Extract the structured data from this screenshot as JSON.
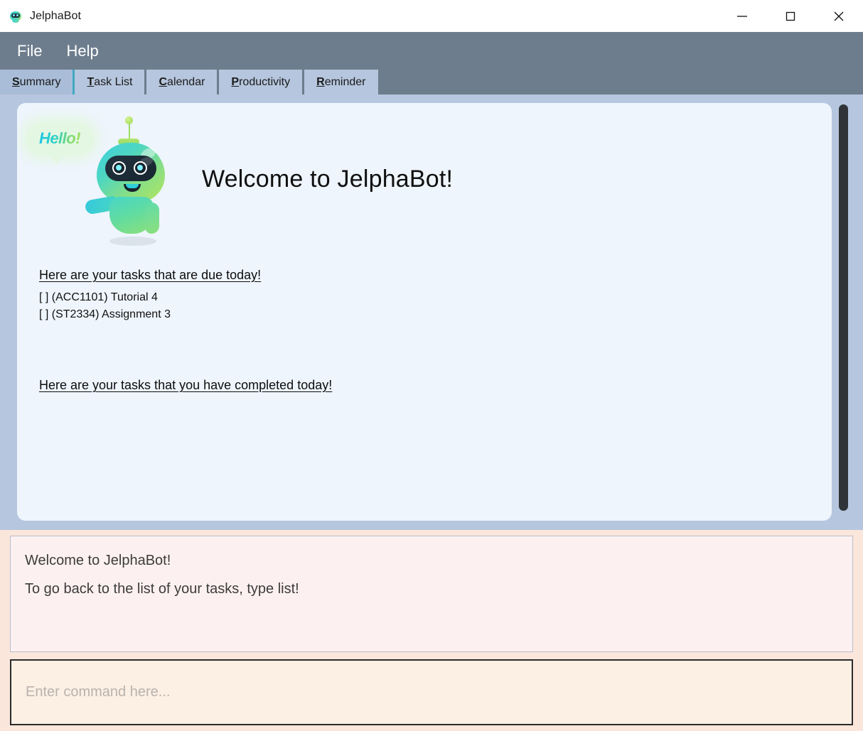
{
  "window": {
    "title": "JelphaBot",
    "icon": "robot-icon",
    "controls": {
      "minimize": "minimize-icon",
      "maximize": "maximize-icon",
      "close": "close-icon"
    }
  },
  "menubar": {
    "items": [
      {
        "label": "File"
      },
      {
        "label": "Help"
      }
    ]
  },
  "tabs": [
    {
      "mnemonic": "S",
      "rest": "ummary",
      "label": "Summary",
      "active": true
    },
    {
      "mnemonic": "T",
      "rest": "ask List",
      "label": "Task List",
      "active": false
    },
    {
      "mnemonic": "C",
      "rest": "alendar",
      "label": "Calendar",
      "active": false
    },
    {
      "mnemonic": "P",
      "rest": "roductivity",
      "label": "Productivity",
      "active": false
    },
    {
      "mnemonic": "R",
      "rest": "eminder",
      "label": "Reminder",
      "active": false
    }
  ],
  "summary": {
    "mascot_bubble": "Hello!",
    "welcome_title": "Welcome to JelphaBot!",
    "due_heading": "Here are your tasks that are due today!",
    "due_tasks": [
      "[ ] (ACC1101) Tutorial 4",
      "[ ] (ST2334) Assignment 3"
    ],
    "completed_heading": "Here are your tasks that you have completed today!",
    "completed_tasks": []
  },
  "response": {
    "lines": [
      "Welcome to JelphaBot!",
      "To go back to the list of your tasks, type list!"
    ]
  },
  "command": {
    "value": "",
    "placeholder": "Enter command here..."
  },
  "colors": {
    "window_chrome": "#b6c6de",
    "menubar": "#6d7d8d",
    "tab_active": "#a9bdd8",
    "tab_accent": "#3fa8c4",
    "content_panel": "#eef5fc",
    "response_outer": "#fbe6dc",
    "response_inner": "#fdf0f0",
    "input_bg": "#fcefe4",
    "scrollbar_thumb": "#303438"
  }
}
